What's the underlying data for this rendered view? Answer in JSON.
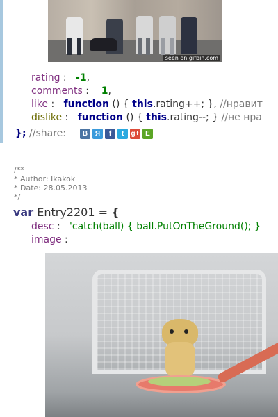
{
  "entry1": {
    "image": {
      "watermark": "seen on gifbin.com"
    },
    "rating_key": "rating",
    "rating_value": "-1",
    "comments_key": "comments",
    "comments_value": "1",
    "like_key": "like",
    "like_fn": "function",
    "like_body_pre": "() { ",
    "like_this": "this",
    "like_body_post": ".rating++; },",
    "like_comment": "//нравит",
    "dislike_key": "dislike",
    "dislike_fn": "function",
    "dislike_body_pre": "() { ",
    "dislike_this": "this",
    "dislike_body_post": ".rating--; }",
    "dislike_comment": "//не нра",
    "close": "};",
    "share_comment": "//share:",
    "share_icons": [
      {
        "name": "vkontakte-icon",
        "glyph": "В",
        "color": "#4c75a3"
      },
      {
        "name": "yandex-icon",
        "glyph": "Я",
        "color": "#3b9bdb"
      },
      {
        "name": "facebook-icon",
        "glyph": "f",
        "color": "#3b5998"
      },
      {
        "name": "twitter-icon",
        "glyph": "t",
        "color": "#2aa9e0"
      },
      {
        "name": "google-plus-icon",
        "glyph": "g+",
        "color": "#dd4b39"
      },
      {
        "name": "evernote-icon",
        "glyph": "E",
        "color": "#5ba525"
      }
    ]
  },
  "entry2": {
    "comment_open": "/**",
    "author": " * Author: Ikakok",
    "date": " * Date: 28.05.2013",
    "comment_close": " */",
    "var_kw": "var",
    "var_name": "Entry2201",
    "var_eq": " = ",
    "brace": "{",
    "desc_key": "desc",
    "desc_value": "'catch(ball) { ball.PutOnTheGround(); }",
    "image_key": "image"
  }
}
